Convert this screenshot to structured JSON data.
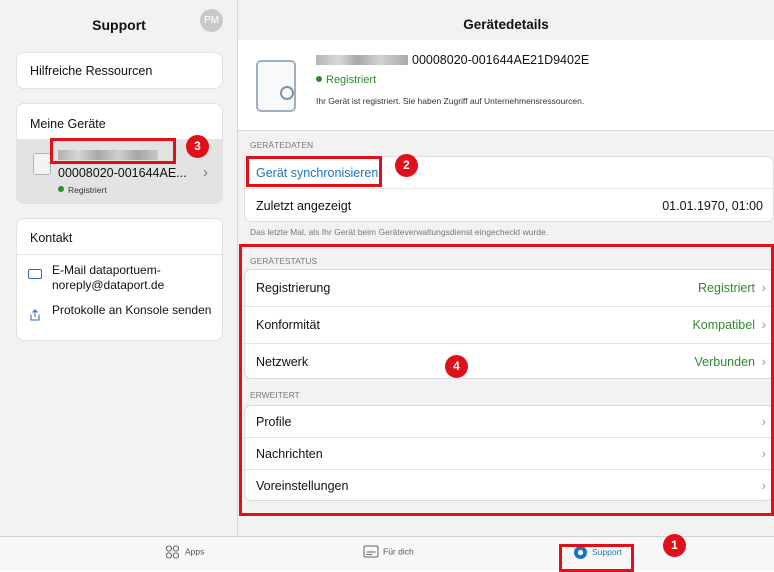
{
  "sidebar": {
    "title": "Support",
    "avatar_initials": "PM",
    "resources_label": "Hilfreiche Ressourcen",
    "devices_title": "Meine Geräte",
    "device": {
      "id": "00008020-001644AE...",
      "status": "Registriert"
    },
    "contact_title": "Kontakt",
    "email_label": "E-Mail dataportuem-noreply@dataport.de",
    "send_logs_label": "Protokolle an Konsole senden"
  },
  "details": {
    "title": "Gerätedetails",
    "device_id": "00008020-001644AE21D9402E",
    "status": "Registriert",
    "status_description": "Ihr Gerät ist registriert. Sie haben Zugriff auf Unternehmensressourcen.",
    "device_data_header": "GERÄTEDATEN",
    "sync_label": "Gerät synchronisieren",
    "last_seen_label": "Zuletzt angezeigt",
    "last_seen_value": "01.01.1970, 01:00",
    "last_seen_note": "Das letzte Mal, als Ihr Gerät beim Geräteverwaltungsdienst eingecheckt wurde.",
    "status_header": "GERÄTESTATUS",
    "status_rows": [
      {
        "label": "Registrierung",
        "value": "Registriert"
      },
      {
        "label": "Konformität",
        "value": "Kompatibel"
      },
      {
        "label": "Netzwerk",
        "value": "Verbunden"
      }
    ],
    "advanced_header": "ERWEITERT",
    "advanced_rows": [
      {
        "label": "Profile"
      },
      {
        "label": "Nachrichten"
      },
      {
        "label": "Voreinstellungen"
      }
    ]
  },
  "tabbar": {
    "apps": "Apps",
    "for_you": "Für dich",
    "support": "Support"
  },
  "annotations": [
    "1",
    "2",
    "3",
    "4"
  ],
  "colors": {
    "accent": "#1e73be",
    "status_green": "#2f8a2f",
    "annotation_red": "#e0101b"
  }
}
